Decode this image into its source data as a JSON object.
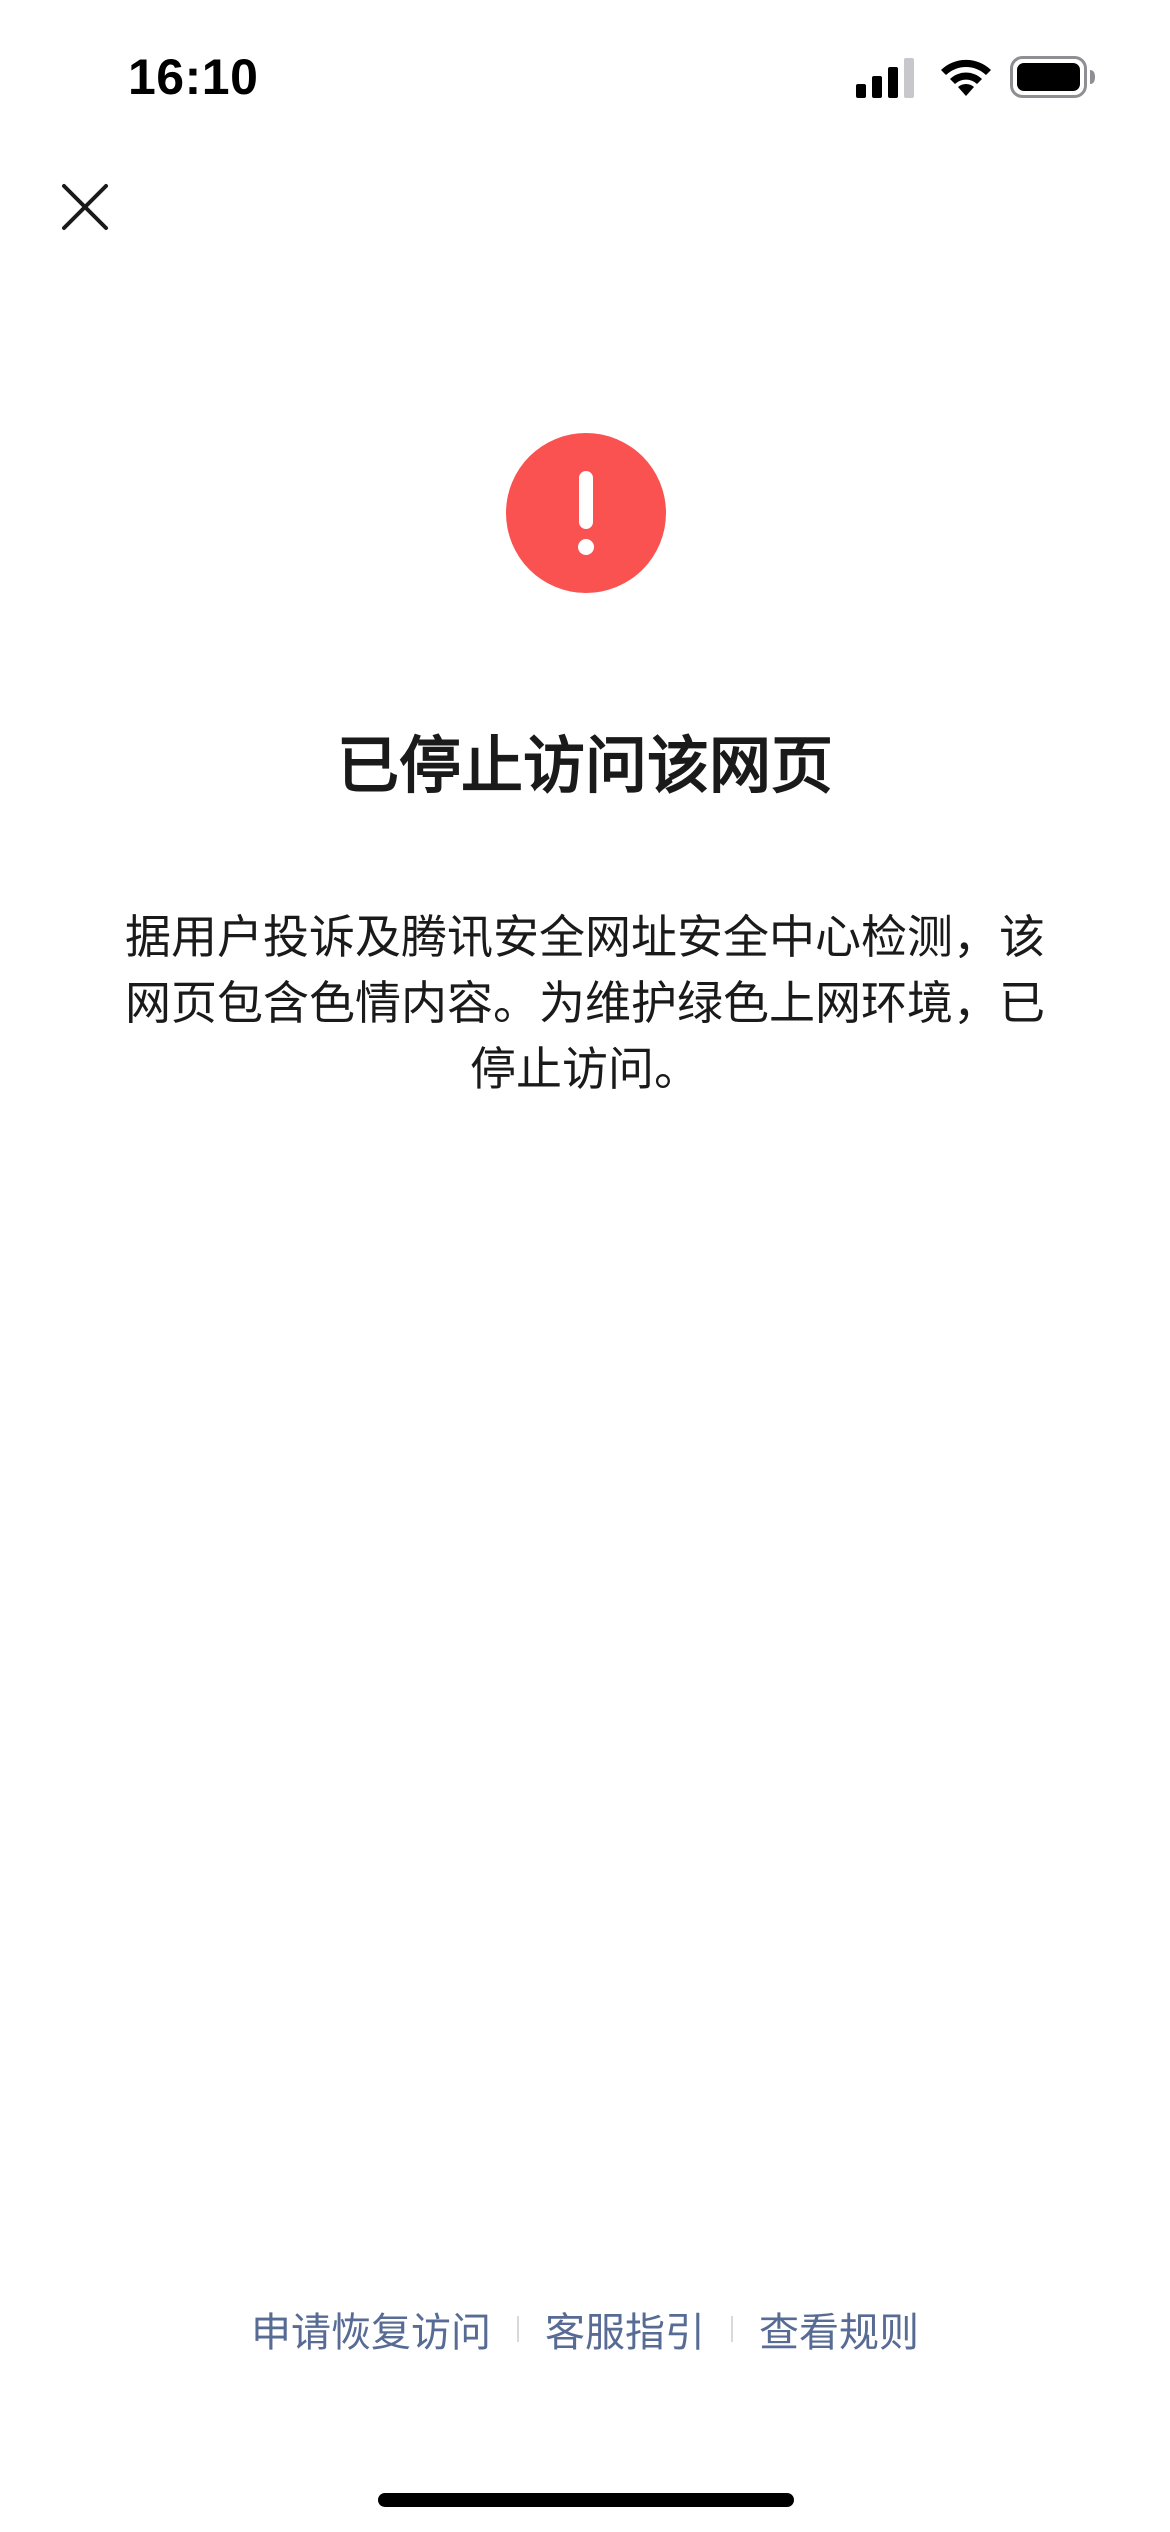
{
  "status_bar": {
    "time": "16:10",
    "icons": [
      "signal-icon",
      "wifi-icon",
      "battery-icon"
    ]
  },
  "header": {
    "close_icon": "close-icon"
  },
  "alert": {
    "icon": "exclamation-icon",
    "color": "#fa5151",
    "title": "已停止访问该网页",
    "description": "据用户投诉及腾讯安全网址安全中心检测，该网页包含色情内容。为维护绿色上网环境，已停止访问。"
  },
  "footer": {
    "links": [
      {
        "label": "申请恢复访问"
      },
      {
        "label": "客服指引"
      },
      {
        "label": "查看规则"
      }
    ],
    "link_color": "#576b95"
  }
}
